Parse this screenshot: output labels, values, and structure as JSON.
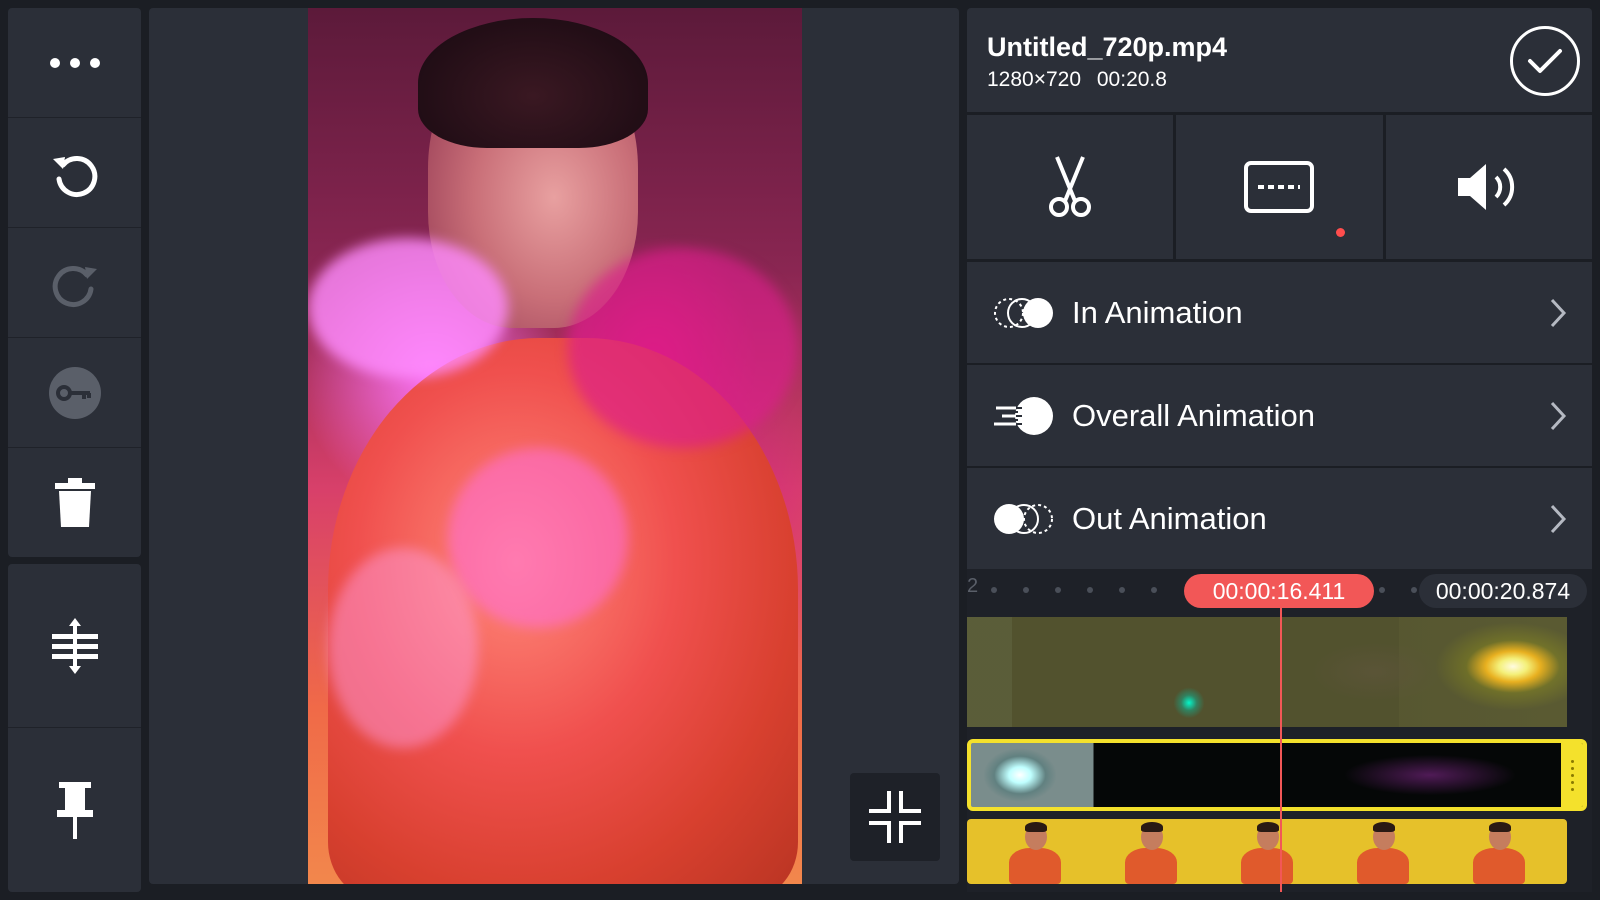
{
  "left_toolbar": {
    "buttons": [
      {
        "name": "more-options",
        "icon": "more-horizontal-icon"
      },
      {
        "name": "undo",
        "icon": "undo-icon"
      },
      {
        "name": "redo",
        "icon": "redo-icon"
      },
      {
        "name": "keyframe",
        "icon": "key-icon"
      },
      {
        "name": "delete",
        "icon": "trash-icon"
      }
    ],
    "buttons_lower": [
      {
        "name": "align-layer",
        "icon": "align-vertical-icon"
      },
      {
        "name": "pin",
        "icon": "pin-icon"
      }
    ]
  },
  "preview": {
    "fullscreen_icon": "exit-fullscreen-icon"
  },
  "header": {
    "file_name": "Untitled_720p.mp4",
    "resolution": "1280×720",
    "duration": "00:20.8",
    "done_icon": "check-circle-icon"
  },
  "edit_tabs": [
    {
      "name": "trim",
      "icon": "scissors-icon"
    },
    {
      "name": "subtitle",
      "icon": "subtitle-icon",
      "indicator": true
    },
    {
      "name": "volume",
      "icon": "volume-icon"
    }
  ],
  "animations": [
    {
      "label": "In Animation",
      "icon": "in-animation-icon"
    },
    {
      "label": "Overall Animation",
      "icon": "overall-animation-icon"
    },
    {
      "label": "Out Animation",
      "icon": "out-animation-icon"
    }
  ],
  "timeline": {
    "ruler_start_label": "2",
    "current_time": "00:00:16.411",
    "total_time": "00:00:20.874"
  },
  "colors": {
    "accent_red": "#f25757",
    "selection_yellow": "#f4e12c",
    "panel_bg": "#2b2f38",
    "app_bg": "#1b1e24"
  }
}
